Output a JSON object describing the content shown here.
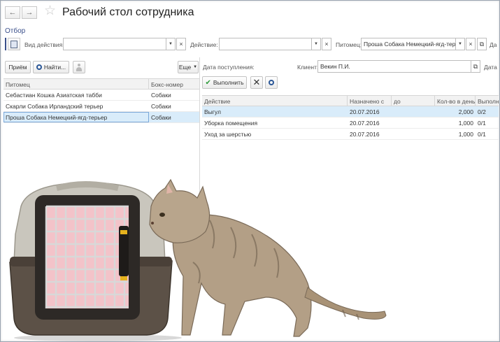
{
  "header": {
    "title": "Рабочий стол сотрудника"
  },
  "filter": {
    "link": "Отбор",
    "action_type_label": "Вид действия:",
    "action_type_value": "",
    "action_label": "Действие:",
    "action_value": "",
    "pet_label": "Питомец:",
    "pet_value": "Проша Собака Немецкий-ягд-терьер",
    "extra_label": "Да"
  },
  "left": {
    "receive_button": "Приём",
    "find_button": "Найти...",
    "more_button": "Еще",
    "columns": [
      "Питомец",
      "Бокс-номер"
    ],
    "rows": [
      {
        "pet": "Себастиан Кошка Азиатская табби",
        "box": "Собаки"
      },
      {
        "pet": "Скарли Собака Ирландский терьер",
        "box": "Собаки"
      },
      {
        "pet": "Проша Собака Немецкий-ягд-терьер",
        "box": "Собаки",
        "selected": true
      }
    ]
  },
  "right": {
    "arrival_label": "Дата поступления:",
    "client_label": "Клиент:",
    "client_value": "Векин П.И.",
    "date_label": "Дата",
    "execute_button": "Выполнить",
    "columns": [
      "Действие",
      "Назначено с",
      "до",
      "Кол-во в день",
      "Выполне"
    ],
    "rows": [
      {
        "action": "Выгул",
        "from": "20.07.2016",
        "to": "",
        "per_day": "2,000",
        "done": "0/2",
        "selected": true
      },
      {
        "action": "Уборка помещения",
        "from": "20.07.2016",
        "to": "",
        "per_day": "1,000",
        "done": "0/1"
      },
      {
        "action": "Уход за шерстью",
        "from": "20.07.2016",
        "to": "",
        "per_day": "1,000",
        "done": "0/1"
      }
    ]
  },
  "colors": {
    "accent": "#3a4f8a",
    "selection": "#d9ecfa",
    "check": "#2e9a3b"
  },
  "icons": [
    "back-arrow-icon",
    "forward-arrow-icon",
    "star-icon",
    "calendar-icon",
    "search-icon",
    "person-icon",
    "check-icon",
    "close-icon",
    "search-icon",
    "copy-icon"
  ]
}
